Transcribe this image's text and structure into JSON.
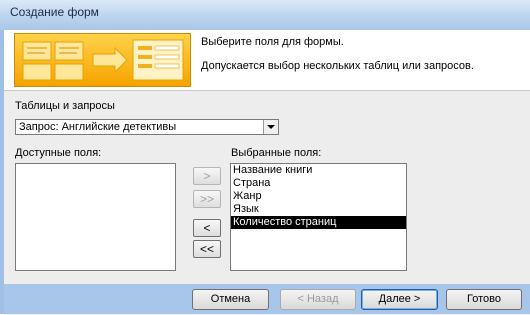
{
  "window": {
    "title": "Создание форм"
  },
  "header": {
    "line1": "Выберите поля для формы.",
    "line2": "Допускается выбор нескольких таблиц или запросов."
  },
  "source": {
    "label": "Таблицы и запросы",
    "selected": "Запрос: Английские детективы"
  },
  "available": {
    "label": "Доступные поля:",
    "items": []
  },
  "selected_fields": {
    "label": "Выбранные поля:",
    "items": [
      "Название книги",
      "Страна",
      "Жанр",
      "Язык",
      "Количество страниц"
    ],
    "selected_index": 4
  },
  "move_buttons": {
    "add": ">",
    "add_all": ">>",
    "remove": "<",
    "remove_all": "<<"
  },
  "footer": {
    "cancel": "Отмена",
    "back": "< Назад",
    "next": "Далее >",
    "finish": "Готово"
  }
}
